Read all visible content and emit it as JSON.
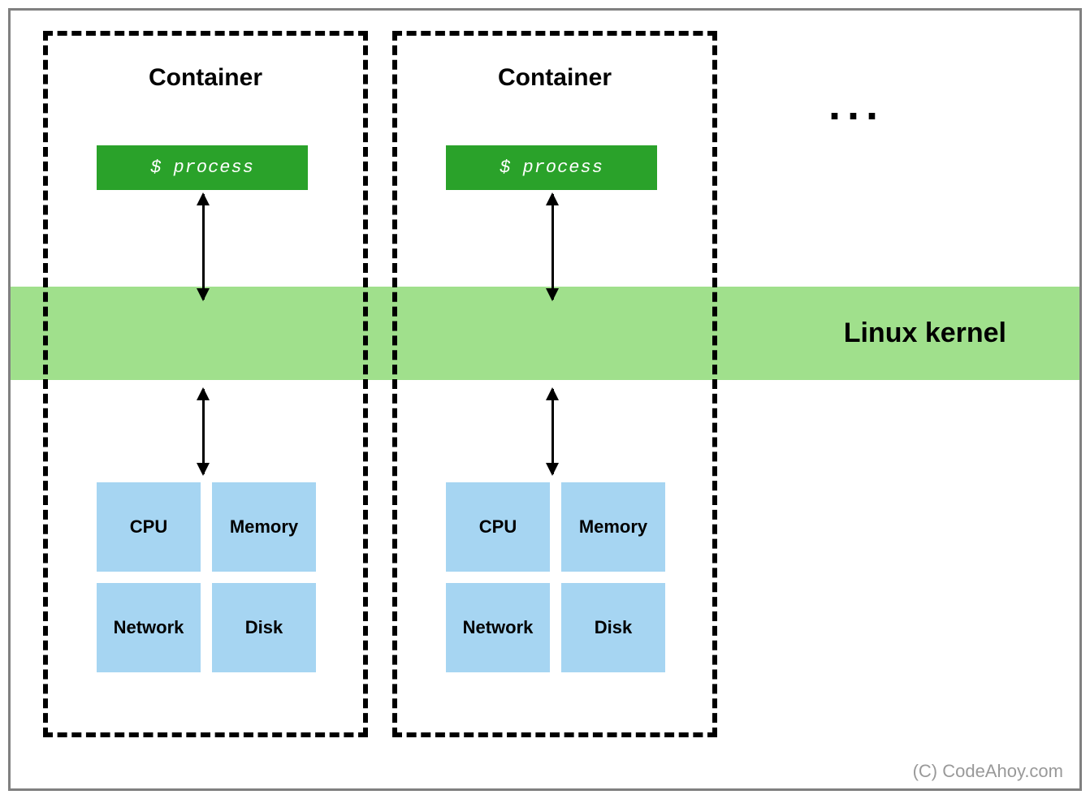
{
  "kernel_label": "Linux kernel",
  "ellipsis": "...",
  "attribution": "(C) CodeAhoy.com",
  "containers": [
    {
      "title": "Container",
      "process_label": "$ process",
      "resources": [
        "CPU",
        "Memory",
        "Network",
        "Disk"
      ]
    },
    {
      "title": "Container",
      "process_label": "$ process",
      "resources": [
        "CPU",
        "Memory",
        "Network",
        "Disk"
      ]
    }
  ]
}
